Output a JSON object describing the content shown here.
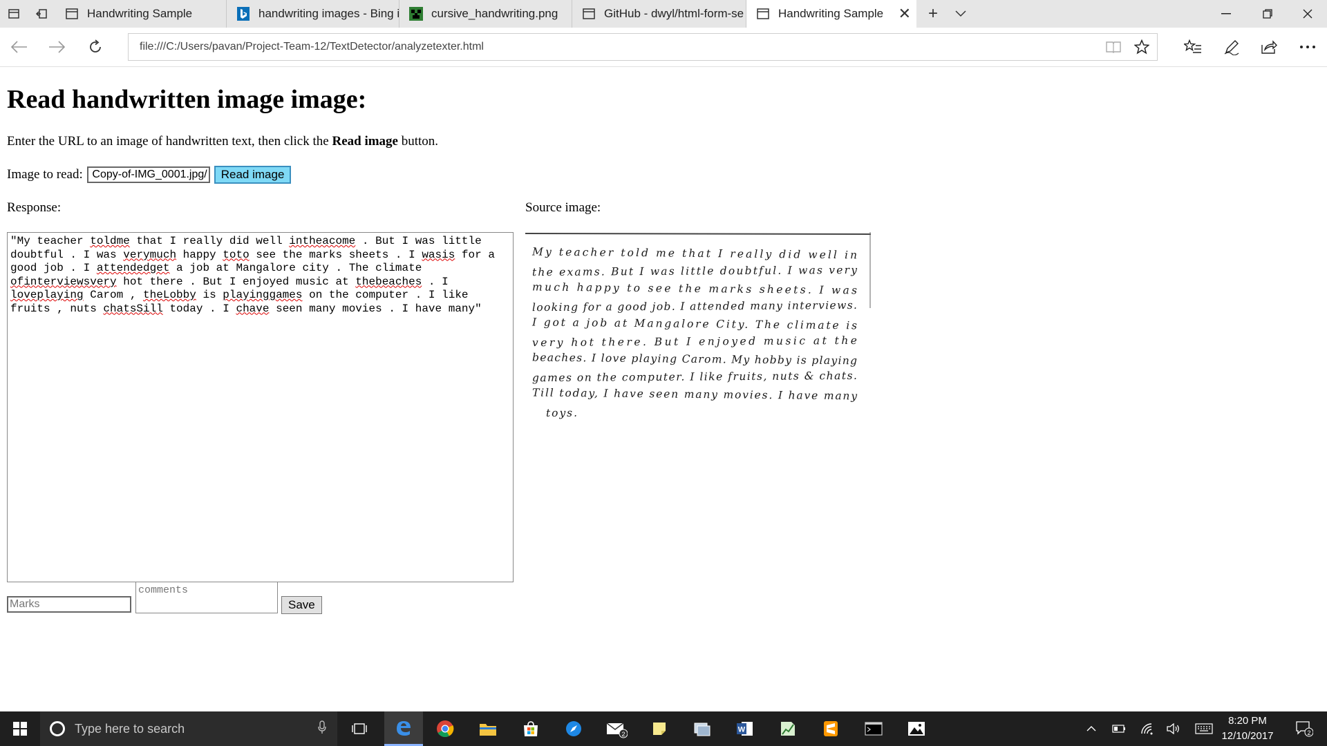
{
  "tabs": [
    {
      "label": "Handwriting Sample",
      "icon": "page-icon"
    },
    {
      "label": "handwriting images - Bing i",
      "icon": "bing-icon"
    },
    {
      "label": "cursive_handwriting.png",
      "icon": "creeper-icon"
    },
    {
      "label": "GitHub - dwyl/html-form-se",
      "icon": "page-icon"
    },
    {
      "label": "Handwriting Sample",
      "icon": "page-icon",
      "active": true
    }
  ],
  "address_bar": {
    "url": "file:///C:/Users/pavan/Project-Team-12/TextDetector/analyzetexter.html"
  },
  "page": {
    "title": "Read handwritten image image:",
    "instruction_prefix": "Enter the URL to an image of handwritten text, then click the ",
    "instruction_bold": "Read image",
    "instruction_suffix": " button.",
    "image_label": "Image to read:",
    "image_input_value": "/Copy-of-IMG_0001.jpg",
    "read_button": "Read image",
    "response_label": "Response:",
    "source_label": "Source image:",
    "response_segments": [
      {
        "t": "\"My teacher "
      },
      {
        "t": "toldme",
        "s": true
      },
      {
        "t": " that I really did well "
      },
      {
        "t": "intheacome",
        "s": true
      },
      {
        "t": " . But I was little doubtful . I was "
      },
      {
        "t": "verymuch",
        "s": true
      },
      {
        "t": " happy "
      },
      {
        "t": "toto",
        "s": true
      },
      {
        "t": " see the marks sheets . I "
      },
      {
        "t": "wasis",
        "s": true
      },
      {
        "t": " for a good job . I "
      },
      {
        "t": "attendedget",
        "s": true
      },
      {
        "t": " a job at Mangalore city . The climate "
      },
      {
        "t": "ofinterviewsvery",
        "s": true
      },
      {
        "t": " hot there . But I enjoyed music at "
      },
      {
        "t": "thebeaches",
        "s": true
      },
      {
        "t": " . I "
      },
      {
        "t": "loveplaying",
        "s": true
      },
      {
        "t": " Carom , "
      },
      {
        "t": "theLobby",
        "s": true
      },
      {
        "t": " is "
      },
      {
        "t": "playinggames",
        "s": true
      },
      {
        "t": " on the computer . I like fruits , nuts "
      },
      {
        "t": "chatsSill",
        "s": true
      },
      {
        "t": " today . I "
      },
      {
        "t": "chave",
        "s": true
      },
      {
        "t": " seen many movies . I have many\""
      }
    ],
    "handwriting_lines": [
      "My teacher told me that I really did well in",
      "the exams. But I was little doubtful. I was very",
      "much happy to see the marks sheets. I was",
      "looking for a good job. I attended many interviews.",
      "I got a job at Mangalore City. The climate is",
      "very hot there. But I enjoyed music at the",
      "beaches. I love playing Carom. My hobby is playing",
      "games on the computer. I like fruits, nuts & chats.",
      "Till today, I have seen many movies. I have many",
      "toys."
    ],
    "marks_placeholder": "Marks",
    "comments_placeholder": "comments",
    "save_button": "Save"
  },
  "taskbar": {
    "search_placeholder": "Type here to search",
    "time": "8:20 PM",
    "date": "12/10/2017",
    "mail_badge": "2",
    "notification_badge": "2"
  },
  "colors": {
    "read_button_bg": "#7fd9f6",
    "taskbar_bg": "#1f1f1f",
    "tabbar_bg": "#e6e6e6"
  }
}
